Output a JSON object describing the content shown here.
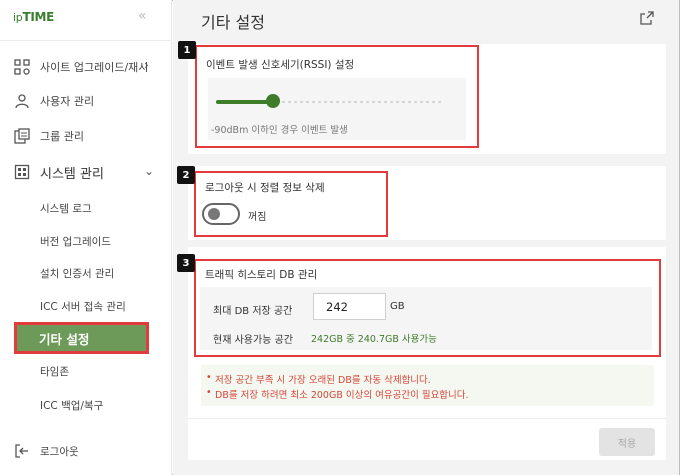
{
  "sidebar": {
    "logo_prefix": "ip",
    "logo_main": "TIME",
    "collapse_icon": "«",
    "items": [
      {
        "label": "사이트 업그레이드/재시",
        "icon": "site-upgrade-icon"
      },
      {
        "label": "사용자 관리",
        "icon": "user-icon"
      },
      {
        "label": "그룹 관리",
        "icon": "group-icon"
      },
      {
        "label": "시스템 관리",
        "icon": "system-icon"
      }
    ],
    "sub_items": [
      "시스템 로그",
      "버전 업그레이드",
      "설치 인증서 관리",
      "ICC 서버 접속 관리",
      "기타 설정",
      "타임존",
      "ICC 백업/복구"
    ],
    "logout": "로그아웃"
  },
  "main": {
    "title": "기타 설정",
    "section1": {
      "badge": "1",
      "title": "이벤트 발생 신호세기(RSSI) 설정",
      "slider_value": 0.25,
      "note": "-90dBm 이하인 경우 이벤트 발생"
    },
    "section2": {
      "badge": "2",
      "title": "로그아웃 시 정렬 정보 삭제",
      "toggle_label": "꺼짐"
    },
    "section3": {
      "badge": "3",
      "title": "트래픽 히스토리 DB 관리",
      "max_label": "최대 DB 저장 공간",
      "max_value": "242",
      "unit": "GB",
      "avail_label": "현재 사용가능 공간",
      "avail_value": "242GB 중 240.7GB 사용가능"
    },
    "warnings": [
      "저장 공간 부족 시 가장 오래된 DB를 자동 삭제합니다.",
      "DB를 저장 하려면 최소 200GB 이상의 여유공간이 필요합니다."
    ],
    "apply": "적용"
  },
  "colors": {
    "brand_green": "#3e7c2a",
    "active_bg": "#6d9a58",
    "highlight_red": "#e33b3b",
    "warn_red": "#d4463b"
  }
}
